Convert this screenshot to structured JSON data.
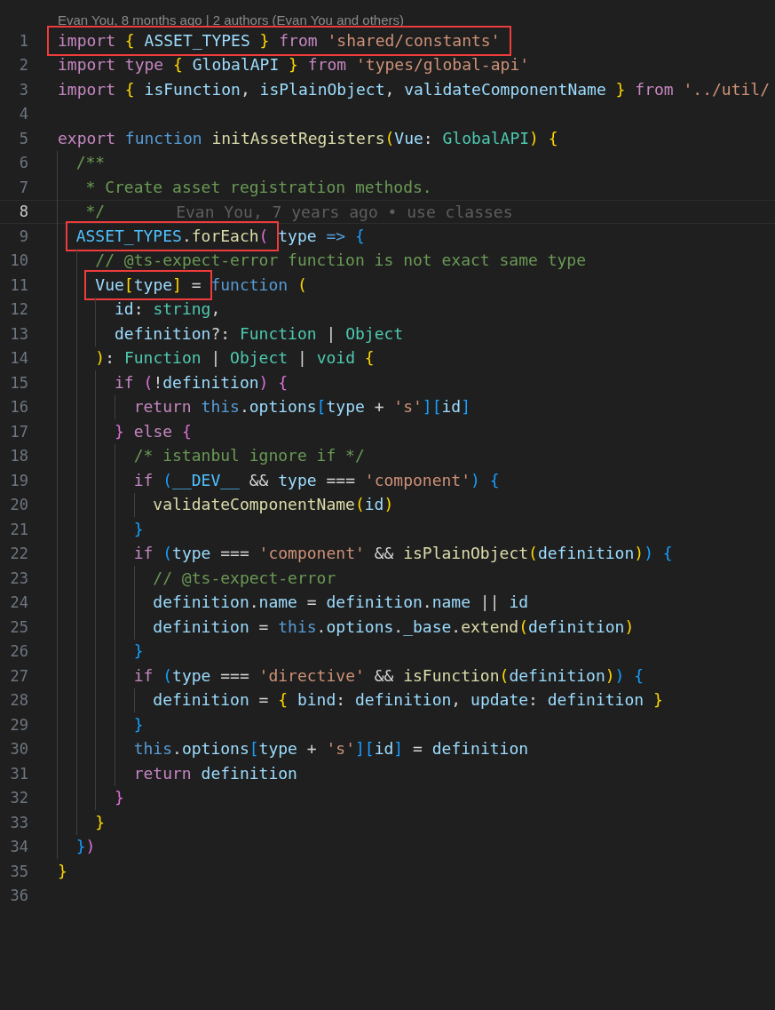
{
  "codelens": "Evan You, 8 months ago | 2 authors (Evan You and others)",
  "lines": [
    {
      "number": "1",
      "current": false,
      "marked": [
        {
          "text": "import ",
          "kind": "kw"
        },
        {
          "text": "{ ",
          "kind": "b1"
        },
        {
          "text": "ASSET_TYPES ",
          "kind": "var"
        },
        {
          "text": "} ",
          "kind": "b1"
        },
        {
          "text": "from ",
          "kind": "kw"
        },
        {
          "text": "'shared/constants'",
          "kind": "str"
        }
      ]
    },
    {
      "number": "2",
      "current": false,
      "tokens": [
        {
          "text": "import type ",
          "kind": "kw"
        },
        {
          "text": "{ ",
          "kind": "b1"
        },
        {
          "text": "GlobalAPI ",
          "kind": "var"
        },
        {
          "text": "} ",
          "kind": "b1"
        },
        {
          "text": "from ",
          "kind": "kw"
        },
        {
          "text": "'types/global-api'",
          "kind": "str"
        }
      ]
    },
    {
      "number": "3",
      "current": false,
      "tokens": [
        {
          "text": "import ",
          "kind": "kw"
        },
        {
          "text": "{ ",
          "kind": "b1"
        },
        {
          "text": "isFunction",
          "kind": "var"
        },
        {
          "text": ", ",
          "kind": "pl"
        },
        {
          "text": "isPlainObject",
          "kind": "var"
        },
        {
          "text": ", ",
          "kind": "pl"
        },
        {
          "text": "validateComponentName ",
          "kind": "var"
        },
        {
          "text": "} ",
          "kind": "b1"
        },
        {
          "text": "from ",
          "kind": "kw"
        },
        {
          "text": "'../util/",
          "kind": "str"
        }
      ]
    },
    {
      "number": "4",
      "current": false
    },
    {
      "number": "5",
      "current": false,
      "tokens": [
        {
          "text": "export ",
          "kind": "kw"
        },
        {
          "text": "function ",
          "kind": "st"
        },
        {
          "text": "initAssetRegisters",
          "kind": "fn"
        },
        {
          "text": "(",
          "kind": "b1"
        },
        {
          "text": "Vue",
          "kind": "var"
        },
        {
          "text": ": ",
          "kind": "pl"
        },
        {
          "text": "GlobalAPI",
          "kind": "ty"
        },
        {
          "text": ") ",
          "kind": "b1"
        },
        {
          "text": "{",
          "kind": "b1"
        }
      ],
      "children": [
        {
          "number": "6",
          "current": false,
          "tokens": [
            {
              "text": "/**",
              "kind": "cm"
            }
          ]
        },
        {
          "number": "7",
          "current": false,
          "tokens": [
            {
              "text": " * Create asset registration methods.",
              "kind": "cm"
            }
          ]
        },
        {
          "number": "8",
          "current": true,
          "tokens": [
            {
              "text": " */",
              "kind": "cm"
            }
          ],
          "blame": "Evan You, 7 years ago • use classes"
        },
        {
          "number": "9",
          "current": false,
          "marked": [
            {
              "text": "ASSET_TYPES",
              "kind": "cn"
            },
            {
              "text": ".",
              "kind": "pl"
            },
            {
              "text": "forEach",
              "kind": "fn"
            },
            {
              "text": "(",
              "kind": "b2"
            }
          ],
          "tokens": [
            {
              "text": "type ",
              "kind": "var"
            },
            {
              "text": "=> ",
              "kind": "st"
            },
            {
              "text": "{",
              "kind": "b3"
            }
          ],
          "children": [
            {
              "number": "10",
              "current": false,
              "tokens": [
                {
                  "text": "// @ts-expect-error function is not exact same type",
                  "kind": "cm"
                }
              ]
            },
            {
              "number": "11",
              "current": false,
              "marked": [
                {
                  "text": "Vue",
                  "kind": "var"
                },
                {
                  "text": "[",
                  "kind": "b1"
                },
                {
                  "text": "type",
                  "kind": "var"
                },
                {
                  "text": "]",
                  "kind": "b1"
                },
                {
                  "text": " =",
                  "kind": "pl"
                }
              ],
              "tokens": [
                {
                  "text": "function ",
                  "kind": "st"
                },
                {
                  "text": "(",
                  "kind": "b1"
                }
              ],
              "children": [
                {
                  "number": "12",
                  "current": false,
                  "tokens": [
                    {
                      "text": "id",
                      "kind": "var"
                    },
                    {
                      "text": ": ",
                      "kind": "pl"
                    },
                    {
                      "text": "string",
                      "kind": "ty"
                    },
                    {
                      "text": ",",
                      "kind": "pl"
                    }
                  ]
                },
                {
                  "number": "13",
                  "current": false,
                  "tokens": [
                    {
                      "text": "definition",
                      "kind": "var"
                    },
                    {
                      "text": "?: ",
                      "kind": "pl"
                    },
                    {
                      "text": "Function",
                      "kind": "ty"
                    },
                    {
                      "text": " | ",
                      "kind": "pl"
                    },
                    {
                      "text": "Object",
                      "kind": "ty"
                    }
                  ]
                }
              ]
            },
            {
              "number": "14",
              "current": false,
              "tokens": [
                {
                  "text": ")",
                  "kind": "b1"
                },
                {
                  "text": ": ",
                  "kind": "pl"
                },
                {
                  "text": "Function",
                  "kind": "ty"
                },
                {
                  "text": " | ",
                  "kind": "pl"
                },
                {
                  "text": "Object",
                  "kind": "ty"
                },
                {
                  "text": " | ",
                  "kind": "pl"
                },
                {
                  "text": "void ",
                  "kind": "ty"
                },
                {
                  "text": "{",
                  "kind": "b1"
                }
              ],
              "children": [
                {
                  "number": "15",
                  "current": false,
                  "tokens": [
                    {
                      "text": "if ",
                      "kind": "kw"
                    },
                    {
                      "text": "(",
                      "kind": "b2"
                    },
                    {
                      "text": "!",
                      "kind": "pl"
                    },
                    {
                      "text": "definition",
                      "kind": "var"
                    },
                    {
                      "text": ") ",
                      "kind": "b2"
                    },
                    {
                      "text": "{",
                      "kind": "b2"
                    }
                  ],
                  "children": [
                    {
                      "number": "16",
                      "current": false,
                      "tokens": [
                        {
                          "text": "return ",
                          "kind": "kw"
                        },
                        {
                          "text": "this",
                          "kind": "st"
                        },
                        {
                          "text": ".",
                          "kind": "pl"
                        },
                        {
                          "text": "options",
                          "kind": "var"
                        },
                        {
                          "text": "[",
                          "kind": "b3"
                        },
                        {
                          "text": "type",
                          "kind": "var"
                        },
                        {
                          "text": " + ",
                          "kind": "pl"
                        },
                        {
                          "text": "'s'",
                          "kind": "str"
                        },
                        {
                          "text": "][",
                          "kind": "b3"
                        },
                        {
                          "text": "id",
                          "kind": "var"
                        },
                        {
                          "text": "]",
                          "kind": "b3"
                        }
                      ]
                    }
                  ]
                },
                {
                  "number": "17",
                  "current": false,
                  "tokens": [
                    {
                      "text": "} ",
                      "kind": "b2"
                    },
                    {
                      "text": "else ",
                      "kind": "kw"
                    },
                    {
                      "text": "{",
                      "kind": "b2"
                    }
                  ],
                  "children": [
                    {
                      "number": "18",
                      "current": false,
                      "tokens": [
                        {
                          "text": "/* istanbul ignore if */",
                          "kind": "cm"
                        }
                      ]
                    },
                    {
                      "number": "19",
                      "current": false,
                      "tokens": [
                        {
                          "text": "if ",
                          "kind": "kw"
                        },
                        {
                          "text": "(",
                          "kind": "b3"
                        },
                        {
                          "text": "__DEV__",
                          "kind": "cn"
                        },
                        {
                          "text": " && ",
                          "kind": "pl"
                        },
                        {
                          "text": "type",
                          "kind": "var"
                        },
                        {
                          "text": " === ",
                          "kind": "pl"
                        },
                        {
                          "text": "'component'",
                          "kind": "str"
                        },
                        {
                          "text": ") ",
                          "kind": "b3"
                        },
                        {
                          "text": "{",
                          "kind": "b3"
                        }
                      ],
                      "children": [
                        {
                          "number": "20",
                          "current": false,
                          "tokens": [
                            {
                              "text": "validateComponentName",
                              "kind": "fn"
                            },
                            {
                              "text": "(",
                              "kind": "b1"
                            },
                            {
                              "text": "id",
                              "kind": "var"
                            },
                            {
                              "text": ")",
                              "kind": "b1"
                            }
                          ]
                        }
                      ]
                    },
                    {
                      "number": "21",
                      "current": false,
                      "tokens": [
                        {
                          "text": "}",
                          "kind": "b3"
                        }
                      ]
                    },
                    {
                      "number": "22",
                      "current": false,
                      "tokens": [
                        {
                          "text": "if ",
                          "kind": "kw"
                        },
                        {
                          "text": "(",
                          "kind": "b3"
                        },
                        {
                          "text": "type",
                          "kind": "var"
                        },
                        {
                          "text": " === ",
                          "kind": "pl"
                        },
                        {
                          "text": "'component'",
                          "kind": "str"
                        },
                        {
                          "text": " && ",
                          "kind": "pl"
                        },
                        {
                          "text": "isPlainObject",
                          "kind": "fn"
                        },
                        {
                          "text": "(",
                          "kind": "b1"
                        },
                        {
                          "text": "definition",
                          "kind": "var"
                        },
                        {
                          "text": ")",
                          "kind": "b1"
                        },
                        {
                          "text": ") ",
                          "kind": "b3"
                        },
                        {
                          "text": "{",
                          "kind": "b3"
                        }
                      ],
                      "children": [
                        {
                          "number": "23",
                          "current": false,
                          "tokens": [
                            {
                              "text": "// @ts-expect-error",
                              "kind": "cm"
                            }
                          ]
                        },
                        {
                          "number": "24",
                          "current": false,
                          "tokens": [
                            {
                              "text": "definition",
                              "kind": "var"
                            },
                            {
                              "text": ".",
                              "kind": "pl"
                            },
                            {
                              "text": "name",
                              "kind": "var"
                            },
                            {
                              "text": " = ",
                              "kind": "pl"
                            },
                            {
                              "text": "definition",
                              "kind": "var"
                            },
                            {
                              "text": ".",
                              "kind": "pl"
                            },
                            {
                              "text": "name",
                              "kind": "var"
                            },
                            {
                              "text": " || ",
                              "kind": "pl"
                            },
                            {
                              "text": "id",
                              "kind": "var"
                            }
                          ]
                        },
                        {
                          "number": "25",
                          "current": false,
                          "tokens": [
                            {
                              "text": "definition",
                              "kind": "var"
                            },
                            {
                              "text": " = ",
                              "kind": "pl"
                            },
                            {
                              "text": "this",
                              "kind": "st"
                            },
                            {
                              "text": ".",
                              "kind": "pl"
                            },
                            {
                              "text": "options",
                              "kind": "var"
                            },
                            {
                              "text": ".",
                              "kind": "pl"
                            },
                            {
                              "text": "_base",
                              "kind": "var"
                            },
                            {
                              "text": ".",
                              "kind": "pl"
                            },
                            {
                              "text": "extend",
                              "kind": "fn"
                            },
                            {
                              "text": "(",
                              "kind": "b1"
                            },
                            {
                              "text": "definition",
                              "kind": "var"
                            },
                            {
                              "text": ")",
                              "kind": "b1"
                            }
                          ]
                        }
                      ]
                    },
                    {
                      "number": "26",
                      "current": false,
                      "tokens": [
                        {
                          "text": "}",
                          "kind": "b3"
                        }
                      ]
                    },
                    {
                      "number": "27",
                      "current": false,
                      "tokens": [
                        {
                          "text": "if ",
                          "kind": "kw"
                        },
                        {
                          "text": "(",
                          "kind": "b3"
                        },
                        {
                          "text": "type",
                          "kind": "var"
                        },
                        {
                          "text": " === ",
                          "kind": "pl"
                        },
                        {
                          "text": "'directive'",
                          "kind": "str"
                        },
                        {
                          "text": " && ",
                          "kind": "pl"
                        },
                        {
                          "text": "isFunction",
                          "kind": "fn"
                        },
                        {
                          "text": "(",
                          "kind": "b1"
                        },
                        {
                          "text": "definition",
                          "kind": "var"
                        },
                        {
                          "text": ")",
                          "kind": "b1"
                        },
                        {
                          "text": ") ",
                          "kind": "b3"
                        },
                        {
                          "text": "{",
                          "kind": "b3"
                        }
                      ],
                      "children": [
                        {
                          "number": "28",
                          "current": false,
                          "tokens": [
                            {
                              "text": "definition",
                              "kind": "var"
                            },
                            {
                              "text": " = ",
                              "kind": "pl"
                            },
                            {
                              "text": "{ ",
                              "kind": "b1"
                            },
                            {
                              "text": "bind",
                              "kind": "var"
                            },
                            {
                              "text": ": ",
                              "kind": "pl"
                            },
                            {
                              "text": "definition",
                              "kind": "var"
                            },
                            {
                              "text": ", ",
                              "kind": "pl"
                            },
                            {
                              "text": "update",
                              "kind": "var"
                            },
                            {
                              "text": ": ",
                              "kind": "pl"
                            },
                            {
                              "text": "definition ",
                              "kind": "var"
                            },
                            {
                              "text": "}",
                              "kind": "b1"
                            }
                          ]
                        }
                      ]
                    },
                    {
                      "number": "29",
                      "current": false,
                      "tokens": [
                        {
                          "text": "}",
                          "kind": "b3"
                        }
                      ]
                    },
                    {
                      "number": "30",
                      "current": false,
                      "tokens": [
                        {
                          "text": "this",
                          "kind": "st"
                        },
                        {
                          "text": ".",
                          "kind": "pl"
                        },
                        {
                          "text": "options",
                          "kind": "var"
                        },
                        {
                          "text": "[",
                          "kind": "b3"
                        },
                        {
                          "text": "type",
                          "kind": "var"
                        },
                        {
                          "text": " + ",
                          "kind": "pl"
                        },
                        {
                          "text": "'s'",
                          "kind": "str"
                        },
                        {
                          "text": "][",
                          "kind": "b3"
                        },
                        {
                          "text": "id",
                          "kind": "var"
                        },
                        {
                          "text": "]",
                          "kind": "b3"
                        },
                        {
                          "text": " = ",
                          "kind": "pl"
                        },
                        {
                          "text": "definition",
                          "kind": "var"
                        }
                      ]
                    },
                    {
                      "number": "31",
                      "current": false,
                      "tokens": [
                        {
                          "text": "return ",
                          "kind": "kw"
                        },
                        {
                          "text": "definition",
                          "kind": "var"
                        }
                      ]
                    }
                  ]
                },
                {
                  "number": "32",
                  "current": false,
                  "tokens": [
                    {
                      "text": "}",
                      "kind": "b2"
                    }
                  ]
                }
              ]
            },
            {
              "number": "33",
              "current": false,
              "tokens": [
                {
                  "text": "}",
                  "kind": "b1"
                }
              ]
            }
          ]
        },
        {
          "number": "34",
          "current": false,
          "tokens": [
            {
              "text": "}",
              "kind": "b3"
            },
            {
              "text": ")",
              "kind": "b2"
            }
          ]
        }
      ]
    },
    {
      "number": "35",
      "current": false,
      "tokens": [
        {
          "text": "}",
          "kind": "b1"
        }
      ]
    },
    {
      "number": "36",
      "current": false
    }
  ]
}
